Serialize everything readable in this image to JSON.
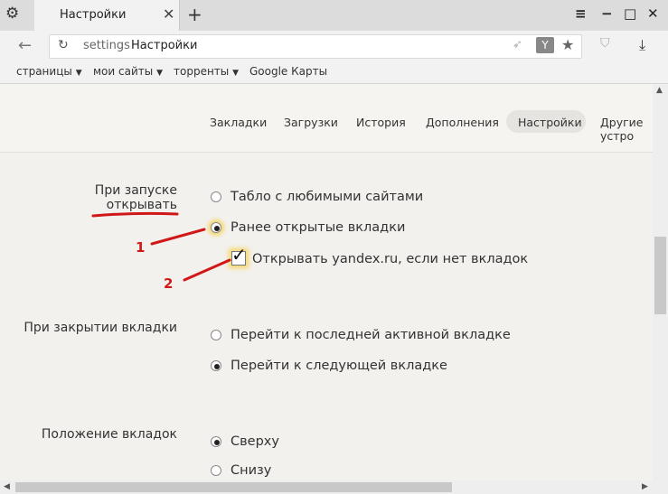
{
  "window": {
    "tab_title": "Настройки",
    "tab_close": "✕",
    "new_tab": "+",
    "menu_icon": "≡",
    "minimize": "−",
    "maximize": "□",
    "close": "✕"
  },
  "address": {
    "prefix": "settings",
    "title": "Настройки"
  },
  "bookmarks": [
    {
      "label": "страницы",
      "caret": "▼"
    },
    {
      "label": "мои сайты",
      "caret": "▼"
    },
    {
      "label": "торренты",
      "caret": "▼"
    },
    {
      "label": "Google Карты",
      "caret": ""
    }
  ],
  "settings_nav": [
    "Закладки",
    "Загрузки",
    "История",
    "Дополнения",
    "Настройки",
    "Другие устро"
  ],
  "sections": {
    "startup": {
      "label_line1": "При запуске",
      "label_line2": "открывать",
      "options": [
        "Табло с любимыми сайтами",
        "Ранее открытые вкладки"
      ],
      "selected": 1,
      "checkbox_label": "Открывать yandex.ru, если нет вкладок",
      "checkbox_checked": true
    },
    "close_tab": {
      "label": "При закрытии вкладки",
      "options": [
        "Перейти к последней активной вкладке",
        "Перейти к следующей вкладке"
      ],
      "selected": 1
    },
    "tab_position": {
      "label": "Положение вкладок",
      "options": [
        "Сверху",
        "Снизу"
      ],
      "selected": 0
    }
  },
  "annotations": {
    "marker1": "1",
    "marker2": "2",
    "color": "#d01818"
  },
  "icons": {
    "gear": "gear-icon",
    "back": "back-arrow-icon",
    "reload": "reload-icon",
    "star": "star-icon",
    "download": "download-icon",
    "yandex": "Y"
  }
}
